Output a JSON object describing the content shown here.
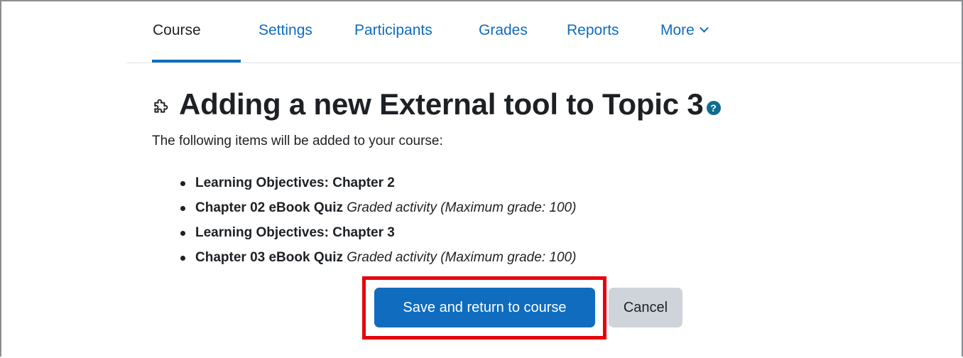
{
  "nav": {
    "tabs": [
      {
        "label": "Course",
        "active": true
      },
      {
        "label": "Settings",
        "active": false
      },
      {
        "label": "Participants",
        "active": false
      },
      {
        "label": "Grades",
        "active": false
      },
      {
        "label": "Reports",
        "active": false
      },
      {
        "label": "More",
        "active": false,
        "has_dropdown": true
      }
    ]
  },
  "page": {
    "title": "Adding a new External tool to Topic 3",
    "title_icon": "puzzle-icon",
    "help_icon": "help-icon",
    "help_glyph": "?",
    "intro": "The following items will be added to your course:"
  },
  "items": [
    {
      "name": "Learning Objectives: Chapter 2",
      "note": ""
    },
    {
      "name": "Chapter 02 eBook Quiz",
      "note": "Graded activity (Maximum grade: 100)"
    },
    {
      "name": "Learning Objectives: Chapter 3",
      "note": ""
    },
    {
      "name": "Chapter 03 eBook Quiz",
      "note": "Graded activity (Maximum grade: 100)"
    }
  ],
  "actions": {
    "save_label": "Save and return to course",
    "cancel_label": "Cancel"
  },
  "colors": {
    "primary": "#0f6cbf",
    "highlight": "#e8000b",
    "secondary_button": "#ced4da",
    "text": "#1d2125"
  }
}
